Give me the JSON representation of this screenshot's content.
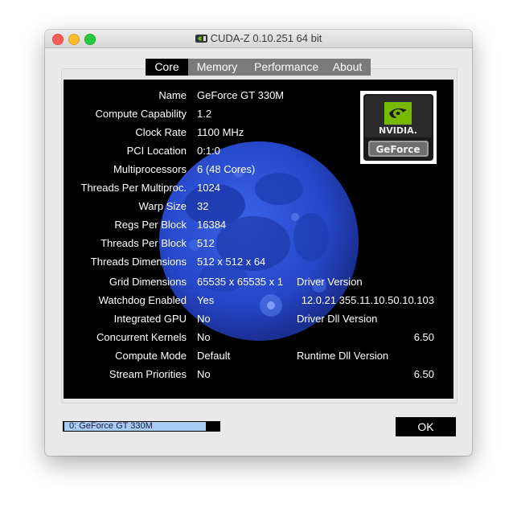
{
  "window": {
    "title": "CUDA-Z 0.10.251 64 bit"
  },
  "tabs": [
    {
      "label": "Core",
      "active": true
    },
    {
      "label": "Memory",
      "active": false
    },
    {
      "label": "Performance",
      "active": false
    },
    {
      "label": "About",
      "active": false
    }
  ],
  "core": {
    "rows": [
      {
        "label": "Name",
        "value": "GeForce GT 330M"
      },
      {
        "label": "Compute Capability",
        "value": "1.2"
      },
      {
        "label": "Clock Rate",
        "value": "1100 MHz"
      },
      {
        "label": "PCI Location",
        "value": "0:1:0"
      },
      {
        "label": "Multiprocessors",
        "value": "6 (48 Cores)"
      },
      {
        "label": "Threads Per Multiproc.",
        "value": "1024"
      },
      {
        "label": "Warp Size",
        "value": "32"
      },
      {
        "label": "Regs Per Block",
        "value": "16384"
      },
      {
        "label": "Threads Per Block",
        "value": "512"
      },
      {
        "label": "Threads Dimensions",
        "value": "512 x 512 x 64"
      },
      {
        "label": "Grid Dimensions",
        "value": "65535 x 65535 x 1"
      },
      {
        "label": "Watchdog Enabled",
        "value": "Yes"
      },
      {
        "label": "Integrated GPU",
        "value": "No"
      },
      {
        "label": "Concurrent Kernels",
        "value": "No"
      },
      {
        "label": "Compute Mode",
        "value": "Default"
      },
      {
        "label": "Stream Priorities",
        "value": "No"
      }
    ],
    "driver": {
      "driver_version_label": "Driver Version",
      "driver_version_value": "12.0.21 355.11.10.50.10.103",
      "driver_dll_label": "Driver Dll Version",
      "driver_dll_value": "6.50",
      "runtime_dll_label": "Runtime Dll Version",
      "runtime_dll_value": "6.50"
    },
    "logo": {
      "brand_top": "NVIDIA.",
      "brand_bottom": "GeForce"
    }
  },
  "footer": {
    "device_selected": "0: GeForce GT 330M",
    "ok_label": "OK"
  },
  "colors": {
    "panel_bg": "#000000",
    "moon": "#2646c8",
    "tab_active": "#000000",
    "tab_inactive": "#7a7a7a",
    "nvidia_green": "#76b900",
    "selection": "#a8cdf5"
  },
  "icons": {
    "app": "cuda-z-icon",
    "logo": "nvidia-geforce-logo",
    "background": "moon-image"
  }
}
